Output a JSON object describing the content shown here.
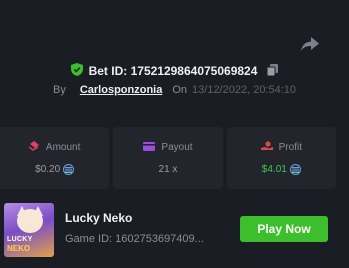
{
  "bet": {
    "id_label": "Bet ID: 1752129864075069824",
    "by_label": "By",
    "username": "Carlosponzonia",
    "on_label": "On",
    "timestamp": "13/12/2022, 20:54:10"
  },
  "stats": {
    "amount": {
      "label": "Amount",
      "value": "$0.20",
      "icon": "amount-icon",
      "color": "#e0406a"
    },
    "payout": {
      "label": "Payout",
      "value": "21 x",
      "icon": "card-icon",
      "color": "#9b4de0"
    },
    "profit": {
      "label": "Profit",
      "value": "$4.01",
      "icon": "profit-icon",
      "color": "#e04848"
    }
  },
  "game": {
    "name": "Lucky Neko",
    "id_label": "Game ID: 1602753697409...",
    "thumb_line1": "LUCKY",
    "thumb_line2": "NEKO",
    "play_label": "Play Now"
  },
  "colors": {
    "background": "#1b1d24",
    "panel": "#23252d",
    "accent_green": "#3cbf2b",
    "profit_green": "#3ec94a",
    "muted_text": "#8b8e98"
  }
}
